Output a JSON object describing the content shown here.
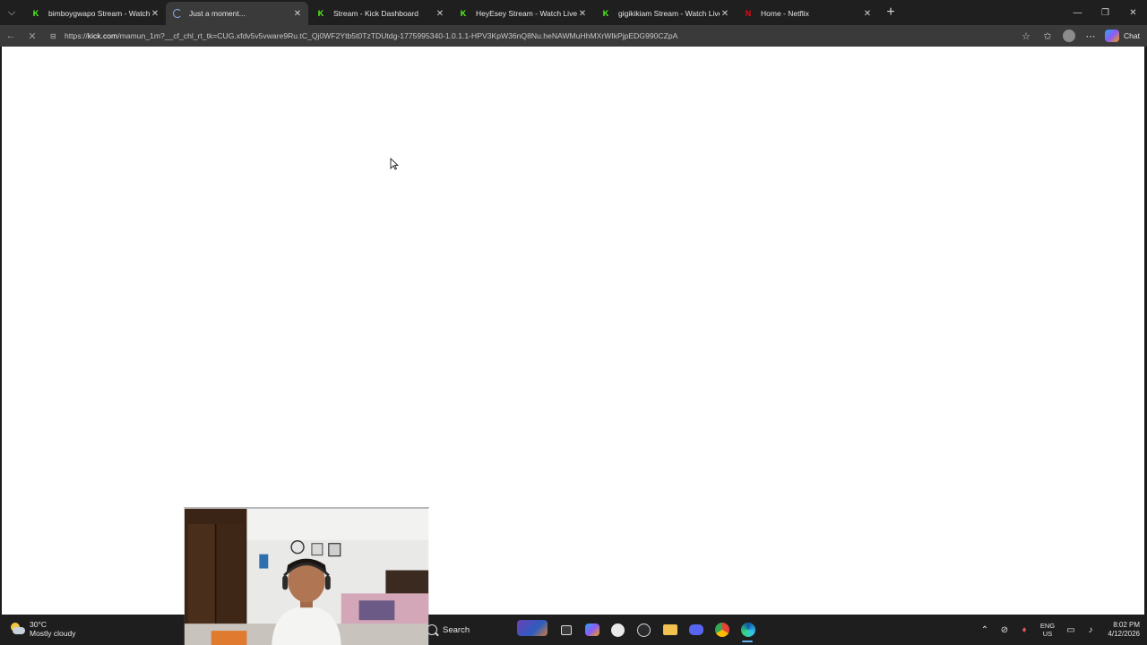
{
  "browser": {
    "tabs": [
      {
        "title": "bimboygwapo Stream - Watch Live on Kick",
        "favicon": "kick-icon",
        "active": false
      },
      {
        "title": "Just a moment...",
        "favicon": "loading-spinner-icon",
        "active": true
      },
      {
        "title": "Stream - Kick Dashboard",
        "favicon": "kick-icon",
        "active": false
      },
      {
        "title": "HeyEsey Stream - Watch Live on Kick",
        "favicon": "kick-icon",
        "active": false
      },
      {
        "title": "gigikikiam Stream - Watch Live on Kick",
        "favicon": "kick-icon",
        "active": false
      },
      {
        "title": "Home - Netflix",
        "favicon": "netflix-icon",
        "active": false
      }
    ],
    "url": {
      "prefix": "https://",
      "host": "kick.com",
      "rest": "/mamun_1m?__cf_chl_rt_tk=CUG.xfdv5v5vware9Ru.tC_Qj0WF2Ytb5t0TzTDUtdg-1775995340-1.0.1.1-HPV3KpW36nQ8Nu.heNAWMuHhMXrWIkPjpEDG990CZpA"
    },
    "chat_label": "Chat"
  },
  "taskbar": {
    "weather": {
      "temperature": "30°C",
      "condition": "Mostly cloudy"
    },
    "search_placeholder": "Search",
    "language": {
      "line1": "ENG",
      "line2": "US"
    },
    "time": "8:02 PM",
    "date": "4/12/2026"
  },
  "colors": {
    "kick_green": "#53fc18",
    "netflix_red": "#e50914",
    "accent_blue": "#8ab4f8"
  }
}
